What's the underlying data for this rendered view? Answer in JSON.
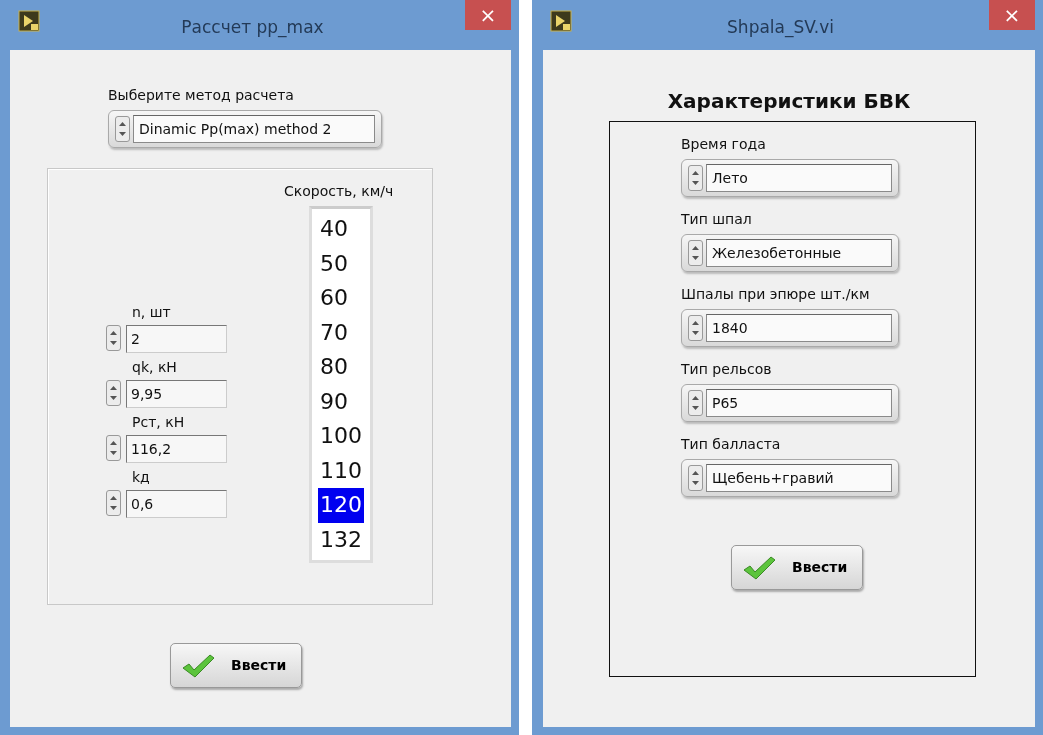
{
  "left_window": {
    "title": "Рассчет pp_max",
    "close_label": "×",
    "method_selector": {
      "label": "Выберите метод расчета",
      "value": "Dinamic Pp(max) method 2"
    },
    "inputs": [
      {
        "label": "n, шт",
        "value": "2"
      },
      {
        "label": "qk, кН",
        "value": "9,95"
      },
      {
        "label": "Рст, кН",
        "value": "116,2"
      },
      {
        "label": "kд",
        "value": "0,6"
      }
    ],
    "speed_list": {
      "label": "Скорость, км/ч",
      "items": [
        {
          "label": "40",
          "selected": false
        },
        {
          "label": "50",
          "selected": false
        },
        {
          "label": "60",
          "selected": false
        },
        {
          "label": "70",
          "selected": false
        },
        {
          "label": "80",
          "selected": false
        },
        {
          "label": "90",
          "selected": false
        },
        {
          "label": "100",
          "selected": false
        },
        {
          "label": "110",
          "selected": false
        },
        {
          "label": "120",
          "selected": true
        },
        {
          "label": "132",
          "selected": false
        }
      ]
    },
    "button": {
      "label": "Ввести"
    }
  },
  "right_window": {
    "title": "Shpala_SV.vi",
    "close_label": "×",
    "heading": "Характеристики БВК",
    "fields": [
      {
        "label": "Время года",
        "value": "Лето"
      },
      {
        "label": "Тип шпал",
        "value": "Железобетонные"
      },
      {
        "label": "Шпалы при эпюре шт./км",
        "value": "1840"
      },
      {
        "label": "Тип рельсов",
        "value": "Р65"
      },
      {
        "label": "Тип балласта",
        "value": "Щебень+гравий"
      }
    ],
    "button": {
      "label": "Ввести"
    }
  }
}
